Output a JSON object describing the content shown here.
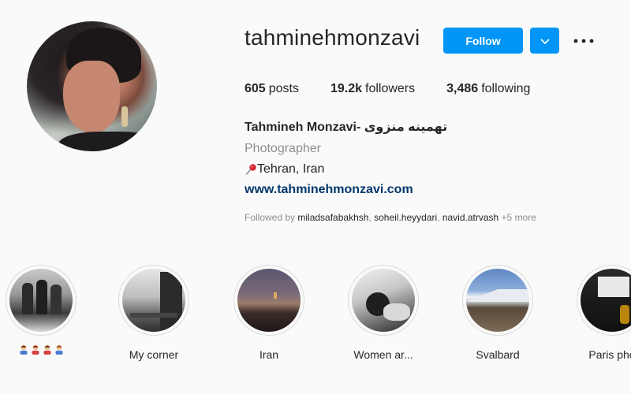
{
  "profile": {
    "username": "tahminehmonzavi",
    "follow_label": "Follow",
    "stats": {
      "posts_count": "605",
      "posts_label": "posts",
      "followers_count": "19.2k",
      "followers_label": "followers",
      "following_count": "3,486",
      "following_label": "following"
    },
    "full_name": "Tahmineh Monzavi- تهمینه منزوی",
    "category": "Photographer",
    "location": "Tehran, Iran",
    "website": "www.tahminehmonzavi.com",
    "followed_by": {
      "prefix": "Followed by",
      "users": [
        "miladsafabakhsh",
        "soheil.heyydari",
        "navid.atrvash"
      ],
      "more": "+5 more"
    }
  },
  "highlights": [
    {
      "label": "",
      "icon": "women-emoji-row"
    },
    {
      "label": "My corner"
    },
    {
      "label": "Iran"
    },
    {
      "label": "Women ar..."
    },
    {
      "label": "Svalbard"
    },
    {
      "label": "Paris pho"
    }
  ],
  "colors": {
    "accent": "#0095f6",
    "link": "#00376b",
    "secondary_text": "#8e8e8e",
    "background": "#fafafa"
  }
}
